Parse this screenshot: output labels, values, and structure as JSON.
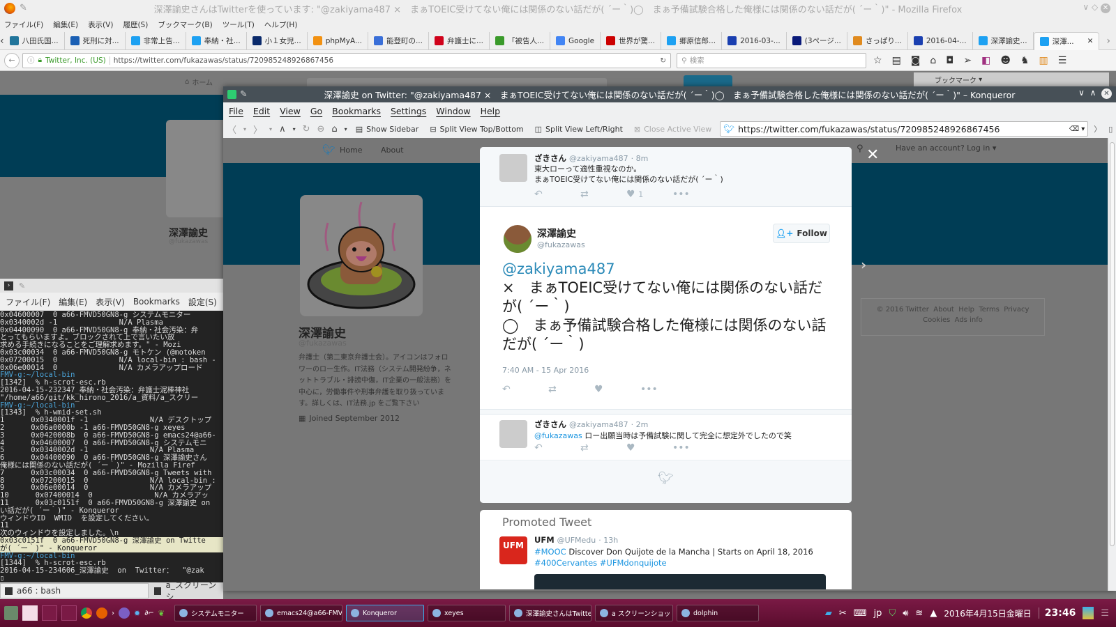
{
  "firefox": {
    "title": "深澤諭史さんはTwitterを使っています: \"@zakiyama487 ×　まぁTOEIC受けてない俺には関係のない話だが( ´ー｀)◯　まぁ予備試験合格した俺様には関係のない話だが( ´ー｀)\" - Mozilla Firefox",
    "menu": [
      "ファイル(F)",
      "編集(E)",
      "表示(V)",
      "履歴(S)",
      "ブックマーク(B)",
      "ツール(T)",
      "ヘルプ(H)"
    ],
    "tabs": [
      {
        "label": "八田氏国...",
        "icon": "wordpress-icon",
        "color": "#21759b"
      },
      {
        "label": "死刑に対...",
        "icon": "site-icon",
        "color": "#1a5fb4"
      },
      {
        "label": "非常上告...",
        "icon": "twitter-icon",
        "color": "#1da1f2"
      },
      {
        "label": "奉納・社...",
        "icon": "twitter-icon",
        "color": "#1da1f2"
      },
      {
        "label": "小１女児...",
        "icon": "news-icon",
        "color": "#0a2a6b"
      },
      {
        "label": "phpMyA...",
        "icon": "phpmyadmin-icon",
        "color": "#f29111"
      },
      {
        "label": "能登町の...",
        "icon": "site-icon",
        "color": "#3a6fd8"
      },
      {
        "label": "弁護士に...",
        "icon": "g-icon",
        "color": "#d0021b"
      },
      {
        "label": "「被告人...",
        "icon": "site-icon",
        "color": "#3a9a2a"
      },
      {
        "label": "Google",
        "icon": "google-icon",
        "color": "#4285f4"
      },
      {
        "label": "世界が驚...",
        "icon": "yahoo-icon",
        "color": "#c00"
      },
      {
        "label": "郷原信郎...",
        "icon": "twitter-icon",
        "color": "#1da1f2"
      },
      {
        "label": "2016-03-...",
        "icon": "d-icon",
        "color": "#1a3fb0"
      },
      {
        "label": "(3ページ...",
        "icon": "site-icon",
        "color": "#0a1a7a"
      },
      {
        "label": "さっぱり...",
        "icon": "site-icon",
        "color": "#e08a1e"
      },
      {
        "label": "2016-04-...",
        "icon": "d-icon",
        "color": "#1a3fb0"
      },
      {
        "label": "深澤諭史...",
        "icon": "twitter-icon",
        "color": "#1da1f2"
      },
      {
        "label": "深澤...",
        "icon": "twitter-icon",
        "color": "#1da1f2",
        "active": true
      }
    ],
    "identity": "Twitter, Inc. (US)",
    "url": "https://twitter.com/fukazawas/status/720985248926867456",
    "search_placeholder": "検索",
    "bookmarks_label": "ブックマーク",
    "bg_nav_home": "ホーム",
    "bg_profile_name": "深澤諭史",
    "bg_profile_handle": "@fukazawas"
  },
  "konsole": {
    "menu": [
      "ファイル(F)",
      "編集(E)",
      "表示(V)",
      "Bookmarks",
      "設定(S)"
    ],
    "lines": [
      {
        "t": "0x04600007  0 a66-FMVD50GN8-g システムモニター"
      },
      {
        "t": "0x0340002d -1              N/A Plasma"
      },
      {
        "t": "0x04400090  0 a66-FMVD50GN8-g 奉納・社会汚染：弁"
      },
      {
        "t": "とってもらいますよ。ブロックされて上で言いたい放"
      },
      {
        "t": "求める手続きになることをご理解求めます。\" - Mozi"
      },
      {
        "t": "0x03c00034  0 a66-FMVD50GN8-g モトケン (@motoken"
      },
      {
        "t": "0x07200015  0              N/A local-bin : bash -"
      },
      {
        "t": "0x06e00014  0              N/A カメラアップロード"
      },
      {
        "t": "FMV-g:~/local-bin",
        "c": "blue"
      },
      {
        "t": "[1342]  % h-scrot-esc.rb"
      },
      {
        "t": "2016-04-15-232347_奉納・社会汚染：弁護士泥棒神社"
      },
      {
        "t": "\"/home/a66/git/kk_hirono_2016/a_資料/a_スクリー"
      },
      {
        "t": "FMV-g:~/local-bin",
        "c": "blue"
      },
      {
        "t": "[1343]  % h-wmid-set.sh"
      },
      {
        "t": "1      0x0340001f -1              N/A デスクトップ"
      },
      {
        "t": "2      0x06a0000b -1 a66-FMVD50GN8-g xeyes"
      },
      {
        "t": "3      0x0420008b  0 a66-FMVD50GN8-g emacs24@a66-"
      },
      {
        "t": "4      0x04600007  0 a66-FMVD50GN8-g システムモニ"
      },
      {
        "t": "5      0x0340002d -1              N/A Plasma"
      },
      {
        "t": "6      0x04400090  0 a66-FMVD50GN8-g 深澤諭史さん"
      },
      {
        "t": "俺様には関係のない話だが( ´ー｀)\" - Mozilla Firef"
      },
      {
        "t": "7      0x03c00034  0 a66-FMVD50GN8-g Tweets with"
      },
      {
        "t": "8      0x07200015  0              N/A local-bin :"
      },
      {
        "t": "9      0x06e00014  0              N/A カメラアップ"
      },
      {
        "t": "10      0x07400014  0              N/A カメラアッ"
      },
      {
        "t": "11      0x03c0151f  0 a66-FMVD50GN8-g 深澤諭史 on"
      },
      {
        "t": "い話だが( ´ー｀)\" - Konqueror"
      },
      {
        "t": "ウィンドウID  WMID  を設定してください。"
      },
      {
        "t": "11"
      },
      {
        "t": "次のウィンドウを設定しました。\\n"
      },
      {
        "t": "0x03c0151f  0 a66-FMVD50GN8-g 深澤諭史 on Twitte",
        "c": "hl"
      },
      {
        "t": "が( ´ー｀)\" - Konqueror",
        "c": "hl"
      },
      {
        "t": "FMV-g:~/local-bin",
        "c": "blue"
      },
      {
        "t": "[1344]  % h-scrot-esc.rb"
      },
      {
        "t": "2016-04-15-234606_深澤諭史  on  Twitter：  \"@zak"
      },
      {
        "t": "▯"
      }
    ],
    "tabs": [
      "a66 : bash",
      "a_スクリーンシ"
    ]
  },
  "konqueror": {
    "title": "深澤諭史 on Twitter: \"@zakiyama487 ×　まぁTOEIC受けてない俺には関係のない話だが( ´ー｀)◯　まぁ予備試験合格した俺様には関係のない話だが( ´ー｀)\" – Konqueror",
    "menu": [
      "File",
      "Edit",
      "View",
      "Go",
      "Bookmarks",
      "Settings",
      "Window",
      "Help"
    ],
    "toolbar": {
      "show_sidebar": "Show Sidebar",
      "split_tb": "Split View Top/Bottom",
      "split_lr": "Split View Left/Right",
      "close_view": "Close Active View"
    },
    "url": "https://twitter.com/fukazawas/status/720985248926867456"
  },
  "twitter": {
    "nav": {
      "home": "Home",
      "about": "About",
      "login": "Have an account? Log in ▾"
    },
    "profile": {
      "name": "深澤諭史",
      "handle": "@fukazawas",
      "bio": "弁護士（第二東京弁護士会）。アイコンはフォロワーのロー生作。IT法務（システム開発紛争，ネットトラブル・誹謗中傷，IT企業の一般法務）を中心に，労働事件や刑事弁護を取り扱っています。詳しくは、IT法務.jp をご覧下さい",
      "joined": "Joined September 2012"
    },
    "parent_tweet": {
      "name": "ざきさん",
      "handle": "@zakiyama487",
      "time": "· 8m",
      "lines": [
        "東大ローって適性重視なのか。",
        "まぁTOEIC受けてない俺には関係のない話だが( ´ー｀)"
      ],
      "likes": "1"
    },
    "main_tweet": {
      "name": "深澤諭史",
      "handle": "@fukazawas",
      "follow": "Follow",
      "mention": "@zakiyama487",
      "line1": "×　まぁTOEIC受けてない俺には関係のない話だが( ´ー｀)",
      "line2": "◯　まぁ予備試験合格した俺様には関係のない話だが( ´ー｀)",
      "timestamp": "7:40 AM - 15 Apr 2016"
    },
    "reply": {
      "name": "ざきさん",
      "handle": "@zakiyama487",
      "time": "· 2m",
      "mention": "@fukazawas",
      "text": "ロー出願当時は予備試験に関して完全に想定外でしたので笑"
    },
    "promoted": {
      "heading": "Promoted Tweet",
      "name": "UFM",
      "handle": "@UFMedu",
      "time": "· 13h",
      "logo": "UFM",
      "hashtag1": "#MOOC",
      "text": "Discover Don Quijote de la Mancha | Starts on April 18, 2016",
      "hashtag2": "#400Cervantes",
      "hashtag3": "#UFMdonquijote"
    },
    "footer": [
      "© 2016 Twitter",
      "About",
      "Help",
      "Terms",
      "Privacy",
      "Cookies",
      "Ads info"
    ]
  },
  "taskbar": {
    "tasks": [
      {
        "label": "システムモニター",
        "icon": "system-monitor-icon"
      },
      {
        "label": "emacs24@a66-FMVD50GN8",
        "icon": "emacs-icon"
      },
      {
        "label": "Konqueror",
        "icon": "konqueror-icon",
        "active": true
      },
      {
        "label": "xeyes",
        "icon": "xeyes-icon"
      },
      {
        "label": "深澤諭史さんはTwitterを使",
        "icon": "firefox-icon"
      },
      {
        "label": "a スクリーンショット : h-scrot",
        "icon": "terminal-icon"
      },
      {
        "label": "dolphin",
        "icon": "dolphin-icon"
      }
    ],
    "ime": "jp",
    "date": "2016年4月15日金曜日",
    "time": "23:46"
  },
  "colors": {
    "twitter_blue": "#1da1f2",
    "banner": "#003d55",
    "taskbar": "#6a1038",
    "konqueror_title": "#475057"
  }
}
